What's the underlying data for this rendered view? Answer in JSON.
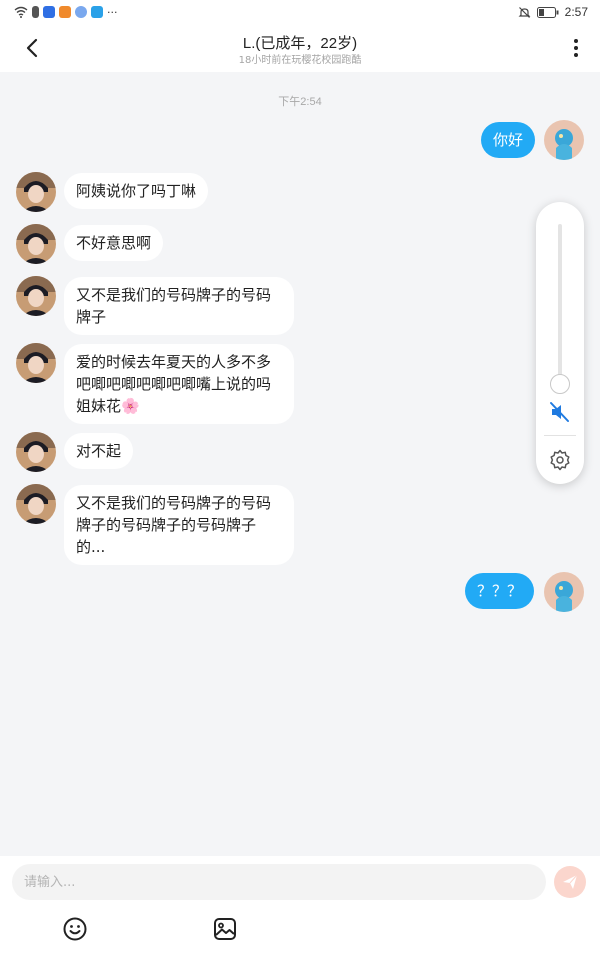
{
  "status_bar": {
    "time": "2:57",
    "left_icons": [
      "wifi-icon",
      "sim-icon",
      "app-icon-blue",
      "app-icon-orange",
      "app-icon-music",
      "app-icon-search",
      "more-dots"
    ],
    "right_icons": [
      "bell-off-icon",
      "battery-icon"
    ]
  },
  "header": {
    "back_icon": "chevron-left-icon",
    "title": "L.(已成年，22岁)",
    "subtitle": "18小时前在玩樱花校园跑酷",
    "more_icon": "more-vertical-icon"
  },
  "chat": {
    "timestamp": "下午2:54",
    "messages": [
      {
        "side": "out",
        "text": "你好"
      },
      {
        "side": "in",
        "text": "阿姨说你了吗丁啉"
      },
      {
        "side": "in",
        "text": "不好意思啊"
      },
      {
        "side": "in",
        "text": "又不是我们的号码牌子的号码牌子"
      },
      {
        "side": "in",
        "text": "爱的时候去年夏天的人多不多吧唧吧唧吧唧吧唧嘴上说的吗姐妹花🌸"
      },
      {
        "side": "in",
        "text": "对不起"
      },
      {
        "side": "in",
        "text": "又不是我们的号码牌子的号码牌子的号码牌子的号码牌子的..."
      },
      {
        "side": "out",
        "text": "？？？"
      }
    ]
  },
  "volume_panel": {
    "level": 0,
    "muted": true,
    "icons": [
      "volume-mute-icon",
      "settings-gear-icon"
    ]
  },
  "input": {
    "placeholder": "请输入...",
    "value": "",
    "send_icon": "send-icon",
    "tools": [
      "emoji-icon",
      "image-icon"
    ]
  },
  "colors": {
    "accent": "#22aaf5",
    "send_button": "#fbd6cd",
    "mute_icon": "#1f7ae0",
    "background": "#f4f5f7"
  }
}
